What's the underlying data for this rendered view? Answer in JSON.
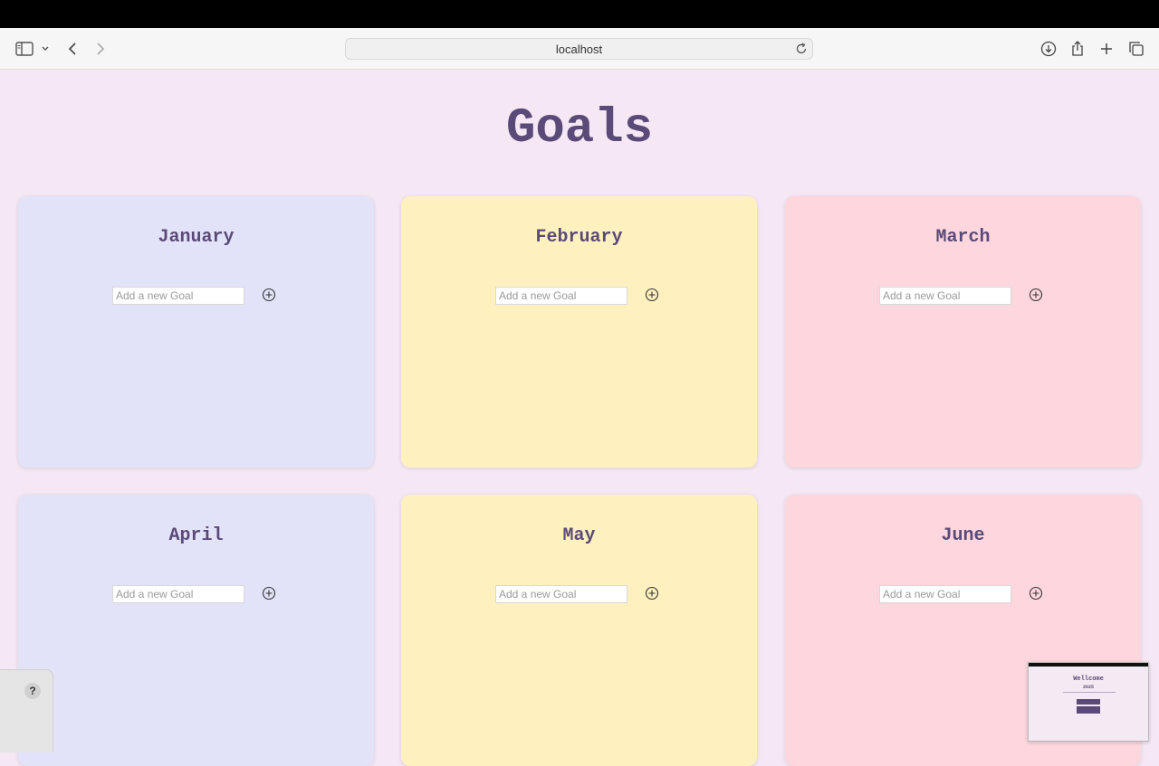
{
  "browser": {
    "address": "localhost",
    "icons": [
      "sidebar-icon",
      "chevron-down-icon",
      "back-icon",
      "forward-icon",
      "reload-icon",
      "download-icon",
      "share-icon",
      "plus-icon",
      "tabs-icon"
    ]
  },
  "page": {
    "title": "Goals",
    "input_placeholder": "Add a new Goal",
    "months": [
      {
        "name": "January",
        "color": "#e2e3f8"
      },
      {
        "name": "February",
        "color": "#fef1bf"
      },
      {
        "name": "March",
        "color": "#fdd6de"
      },
      {
        "name": "April",
        "color": "#e2e3f8"
      },
      {
        "name": "May",
        "color": "#fef1bf"
      },
      {
        "name": "June",
        "color": "#fdd6de"
      }
    ]
  },
  "help": {
    "label": "?"
  },
  "thumbnail": {
    "title": "Wellcome",
    "year": "2025"
  },
  "colors": {
    "accent": "#5a4a78",
    "background": "#f5e8f4"
  }
}
